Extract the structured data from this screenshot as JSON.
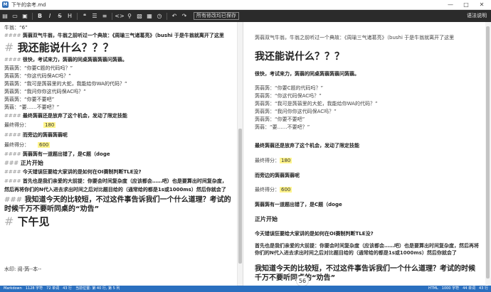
{
  "titlebar": {
    "app_icon": "M",
    "title": "下午的余考.md",
    "controls": [
      "—",
      "□",
      "✕"
    ]
  },
  "toolbar": {
    "buttons": [
      {
        "name": "new-file",
        "label": "▤"
      },
      {
        "name": "open-folder",
        "label": "▭"
      },
      {
        "name": "save",
        "label": "▣"
      },
      {
        "name": "bold",
        "label": "B"
      },
      {
        "name": "italic",
        "label": "I"
      },
      {
        "name": "strikethrough",
        "label": "S"
      },
      {
        "name": "heading",
        "label": "H"
      },
      {
        "name": "quote",
        "label": "❝"
      },
      {
        "name": "bullet-list",
        "label": "☰"
      },
      {
        "name": "number-list",
        "label": "≡"
      },
      {
        "name": "code",
        "label": "<>"
      },
      {
        "name": "link",
        "label": "⚲"
      },
      {
        "name": "image",
        "label": "▧"
      },
      {
        "name": "table",
        "label": "▦"
      },
      {
        "name": "time",
        "label": "◷"
      },
      {
        "name": "undo",
        "label": "↶"
      },
      {
        "name": "redo",
        "label": "↷"
      }
    ],
    "save_status": "所有修改均已保存",
    "syntax_help": "语法说明"
  },
  "editor": {
    "l1": "牛翁：“6”",
    "l2_mark": "####",
    "l2": " 蒟蒻双气牛翁，牛翁之前听过一个典故：《周瑜三气诸葛亮》（bushi  于是牛翁就离开了这里",
    "l3_mark": "#",
    "l3": " 我还能说什么？？？",
    "l4_mark": "####",
    "l4": " 很快，考试来力，蒟蒻的同桌蒟蒻蒟蒻问蒟蒻。",
    "l5": "蒟蒻蒟：“你要C题的代码吗？”",
    "l6": "蒟蒻蒟：“你这代码保AC吗？”",
    "l7": "蒟蒻蒟：“我可是蒟蒻里的大蛇，我能给你WA的代码？”",
    "l8": "蒟蒻蒟：“我问你你这代码保AC吗？”",
    "l9": "蒟蒻蒟：“你要不要吧”",
    "l10": "蒟蒻：“要……不要吧？”",
    "l11_mark": "####",
    "l11": " 最终蒟蒻还是放弃了这个机会，发动了限定技能",
    "l12_label": "最终得分：",
    "l12_value": "180",
    "l13_mark": "####",
    "l13": " 而旁边的蒟蒻蒟蒻呢",
    "l14_label": "最终得分：",
    "l14_value": "600",
    "l15_mark": "####",
    "l15": " 蒟蒻蒟有一道题出错了，是C题（doge",
    "l16_mark": "###",
    "l16": " 正片开始",
    "l17_mark": "####",
    "l17": " 今天错误狂要给大家讲的是如何在OI赛制判断TLE没?",
    "l18_mark": "####",
    "l18": " 首先也是我们亲爱的大前提：你要会时间复杂度（应该都会……吧）也是要算出时间复杂度，",
    "l19": "然后再将你们的N代入进去求出时间之后对比题目给的（通常给的都是1s或1000ms）然后你就会了",
    "l20_mark": "###",
    "l20": " 我知道今天的比较短，不过这件事告诉我们一个什么道理？考试的时候千万不要听同桌的“劝告”",
    "l21_mark": "#",
    "l21": " 下午见",
    "l22": "水印: 阅-蒟--本--"
  },
  "preview": {
    "p1": "蒟蒻双气牛翁，牛翁之前听过一个典故：《周瑜三气诸葛亮》（bushi  于是牛翁就离开了这里",
    "p2": "我还能说什么？？？",
    "p3": "很快，考试来力，蒟蒻的同桌蒟蒻蒟蒻问蒟蒻。",
    "p4": "蒟蒻蒟：“你要C题的代码吗？”",
    "p5": "蒟蒻蒟：“你这代码保AC吗？”",
    "p6": "蒟蒻蒟：“我可是蒟蒻里的大蛇，我能给你WA的代码？”",
    "p7": "蒟蒻蒟：“我问你你这代码保AC吗？”",
    "p8": "蒟蒻蒟：“你要不要吧”",
    "p9": "蒟蒻：“要……不要吧？”",
    "p10": "最终蒟蒻还是放弃了这个机会，发动了限定技能",
    "p11_label": "最终得分：",
    "p11_value": "180",
    "p12": "而旁边的蒟蒻蒟蒻呢",
    "p13_label": "最终得分：",
    "p13_value": "600",
    "p14": "蒟蒻蒟有一道题出错了，是C题（doge",
    "p15": "正片开始",
    "p16": "今天错误狂要给大家讲的是如何在OI赛制判断TLE没?",
    "p17": "首先也是我们亲爱的大前提：你要会时间复杂度（应该都会……吧）也是要算出时间复杂度，然后再将你们的N代入进去求出时间之后对比题目给的（通常给的都是1s或1000ms）然后你就会了",
    "p18": "我知道今天的比较短，不过这件事告诉我们一个什么道理？考试的时候千万不要听同桌的“劝告”",
    "page_badge": "56"
  },
  "statusbar": {
    "mode": "Markdown",
    "left": [
      "1128 字符",
      "72 单词",
      "43 行",
      "当前位置: 第 40 行, 第 5 列"
    ],
    "right": [
      "HTML",
      "1000 字符",
      "44 单词",
      "43 行"
    ]
  }
}
